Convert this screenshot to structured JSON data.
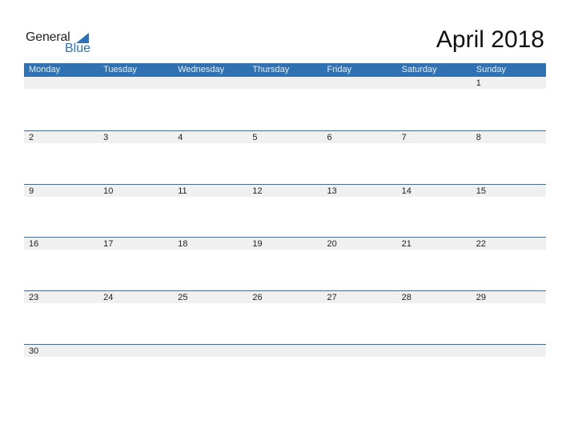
{
  "logo": {
    "general": "General",
    "blue": "Blue"
  },
  "title": "April 2018",
  "accent_color": "#2e72b3",
  "weekdays": [
    "Monday",
    "Tuesday",
    "Wednesday",
    "Thursday",
    "Friday",
    "Saturday",
    "Sunday"
  ],
  "weeks": [
    [
      "",
      "",
      "",
      "",
      "",
      "",
      "1"
    ],
    [
      "2",
      "3",
      "4",
      "5",
      "6",
      "7",
      "8"
    ],
    [
      "9",
      "10",
      "11",
      "12",
      "13",
      "14",
      "15"
    ],
    [
      "16",
      "17",
      "18",
      "19",
      "20",
      "21",
      "22"
    ],
    [
      "23",
      "24",
      "25",
      "26",
      "27",
      "28",
      "29"
    ],
    [
      "30",
      "",
      "",
      "",
      "",
      "",
      ""
    ]
  ]
}
